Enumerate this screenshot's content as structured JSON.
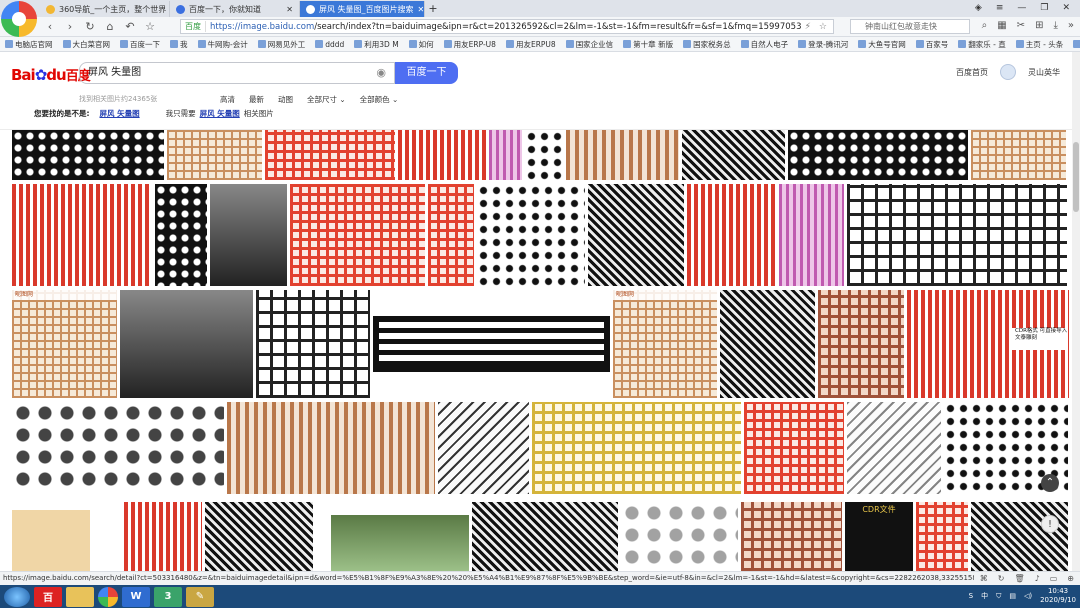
{
  "browser": {
    "tabs": [
      {
        "label": "360导航_一个主页，整个世界",
        "active": false
      },
      {
        "label": "百度一下，你就知道",
        "active": false
      },
      {
        "label": "屏风 失量图_百度图片搜索",
        "active": true
      }
    ],
    "new_tab": "+",
    "address_badge": "百度",
    "url_host": "https://image.baidu.com",
    "url_path": "/search/index?tn=baiduimage&ipn=r&ct=201326592&cl=2&lm=-1&st=-1&fm=result&fr=&sf=1&fmq=1599705335013_R&pv=",
    "side_search": "钟南山红包故意走快",
    "bookmarks": [
      "电脑店官网",
      "大白菜官网",
      "百度一下",
      "我",
      "牛网购-会计",
      "网易见外工",
      "dddd",
      "利用3D M",
      "如何",
      "用友ERP-U8",
      "用友ERPU8",
      "国家企业信",
      "第十章 新版",
      "国家税务总",
      "自然人电子",
      "登录-腾讯河",
      "大鱼号官网",
      "百家号",
      "翻家乐 - 直",
      "主页 - 头条",
      "关键词挖掘"
    ]
  },
  "baidu": {
    "logo_bai": "Bai",
    "logo_du": "du",
    "logo_cn": "百度",
    "query": "屏风 失量图",
    "search_button": "百度一下",
    "home_link": "百度首页",
    "user_name": "灵山英华",
    "found_text": "找到相关图片约24365张",
    "filters": [
      "高清",
      "最新",
      "动图",
      "全部尺寸 ⌄",
      "全部颜色 ⌄"
    ],
    "suggest_prefix": "您要找的是不是:",
    "suggest_query": "屏风 矢量图",
    "suggest_middle": "我只需要",
    "suggest_query2": "屏风 矢量图",
    "suggest_suffix": "相关图片",
    "tag_a": "昵图网",
    "tag_b": "CDR格式 可直接导入文泰雕刻",
    "tag_c": "CDR文件"
  },
  "status": {
    "url": "https://image.baidu.com/search/detail?ct=503316480&z=&tn=baiduimagedetail&ipn=d&word=%E5%B1%8F%E9%A3%8E%20%20%E5%A4%B1%E9%87%8F%E5%9B%BE&step_word=&ie=utf-8&in=&cl=2&lm=-1&st=-1&hd=&latest=&copyright=&cs=2282262038,3325515894&os=2266..."
  },
  "taskbar": {
    "time": "10:43",
    "date": "2020/9/10",
    "ime": "中",
    "apps": [
      "百",
      "3"
    ]
  }
}
